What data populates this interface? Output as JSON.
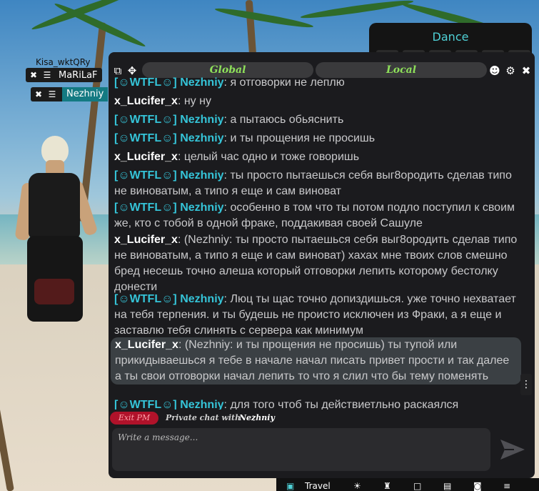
{
  "players": {
    "overhead_nick": "Kisa_wktQRy",
    "plate1": "MaRiLaF",
    "plate2": "Nezhniy"
  },
  "dance": {
    "title": "Dance"
  },
  "chat": {
    "tabs": {
      "global": "Global",
      "local": "Local"
    },
    "messages": [
      {
        "tag": true,
        "name": "[☺WTFL☺] Nezhniy",
        "text": ": я отговорки не леплю"
      },
      {
        "tag": false,
        "name": "x_Lucifer_x",
        "text": ": ну ну"
      },
      {
        "tag": true,
        "name": "[☺WTFL☺] Nezhniy",
        "text": ": а пытаюсь обьяснить"
      },
      {
        "tag": true,
        "name": "[☺WTFL☺] Nezhniy",
        "text": ": и ты прощения не просишь"
      },
      {
        "tag": false,
        "name": "x_Lucifer_x",
        "text": ": целый час одно и тоже говоришь"
      },
      {
        "tag": true,
        "name": "[☺WTFL☺] Nezhniy",
        "text": ": ты просто пытаешься себя выг8ородить сделав типо не виноватым, а типо я еще и сам виноват"
      },
      {
        "tag": true,
        "name": "[☺WTFL☺] Nezhniy",
        "text": ": особенно в том что ты потом подло поступил к своим же, кто с тобой в одной фраке, поддакивая своей Сашуле"
      },
      {
        "tag": false,
        "name": "x_Lucifer_x",
        "text": ": (Nezhniy: ты просто пытаешься себя выг8ородить сделав типо не виноватым, а типо я еще и сам виноват) хахах мне твоих слов смешно бред несешь точно алеша который отговорки лепить которому бестолку донести"
      },
      {
        "tag": true,
        "name": "[☺WTFL☺] Nezhniy",
        "text": ": Люц ты щас точно допиздишься. уже точно нехватает на тебя терпения. и ты будешь не происто исключен из Фраки, а я еще и заставлю тебя слинять с сервера как минимум"
      },
      {
        "tag": false,
        "name": "x_Lucifer_x",
        "text": ": (Nezhniy: и ты прощения не просишь) ты тупой или прикидываешься я тебе в начале начал писать привет прости и так далее а ты свои отговорки начал лепить то что я слил что бы тему поменять",
        "highlight": true
      },
      {
        "tag": true,
        "name": "[☺WTFL☺] Nezhniy",
        "text": ": для того чтоб ты действиетльно раскаялся"
      }
    ],
    "pm": {
      "exit": "Exit PM",
      "label": "Private chat with",
      "nick": "Nezhniy"
    },
    "input_placeholder": "Write a message..."
  },
  "hotbar": {
    "travel": "Travel"
  },
  "colors": {
    "accent_teal": "#35c4d8",
    "channel_green": "#8ee05a",
    "exit_red": "#b0122a"
  },
  "icons": [
    "popout-icon",
    "move-icon",
    "emoji-icon",
    "gear-icon",
    "close-icon",
    "send-icon"
  ]
}
